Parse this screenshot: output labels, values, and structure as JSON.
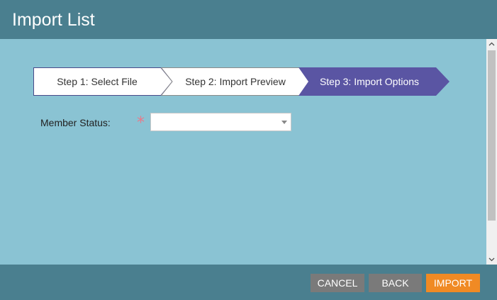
{
  "dialog": {
    "title": "Import List"
  },
  "wizard": {
    "steps": [
      {
        "label": "Step 1: Select File",
        "state": "done"
      },
      {
        "label": "Step 2: Import Preview",
        "state": "done"
      },
      {
        "label": "Step 3: Import Options",
        "state": "active"
      }
    ]
  },
  "form": {
    "member_status": {
      "label": "Member Status:",
      "required_mark": "*",
      "value": ""
    }
  },
  "footer": {
    "cancel_label": "CANCEL",
    "back_label": "BACK",
    "import_label": "IMPORT"
  },
  "colors": {
    "header_bg": "#4a7f8f",
    "body_bg": "#8ac3d3",
    "active_step": "#5a55a3",
    "import_button": "#f08a24",
    "secondary_button": "#7a7a7a"
  },
  "icons": {
    "dropdown": "chevron-down-icon",
    "scroll_up": "arrow-up-icon",
    "scroll_down": "arrow-down-icon"
  }
}
